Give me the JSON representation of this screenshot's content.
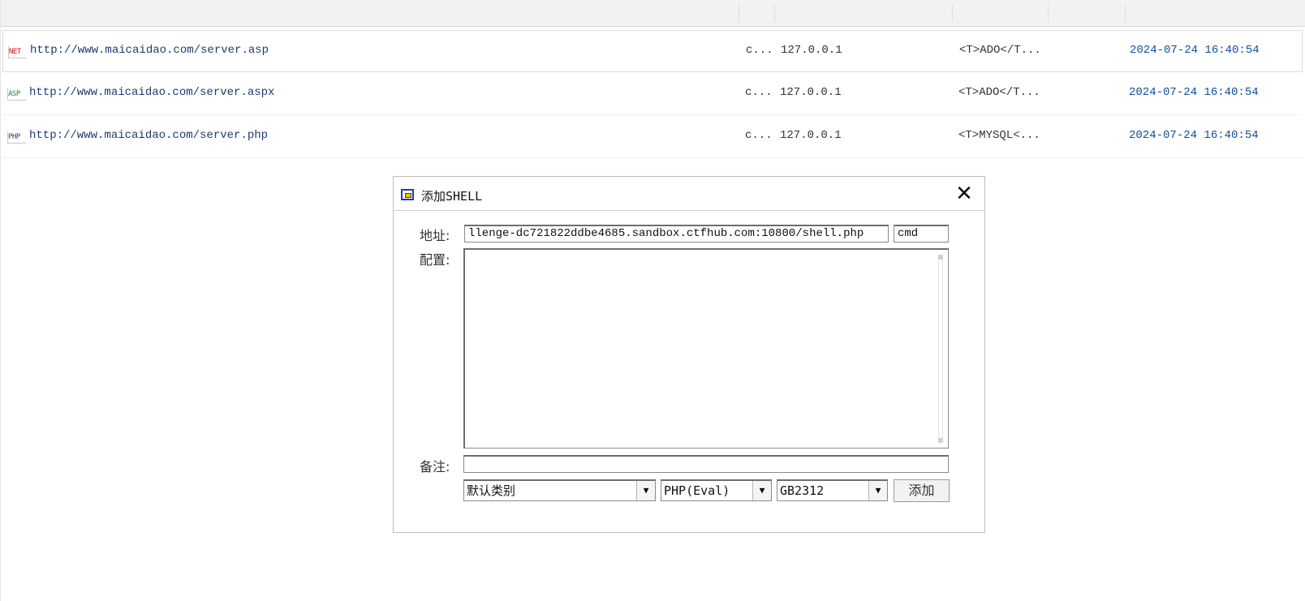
{
  "list": {
    "rows": [
      {
        "type_icon": "NET",
        "icon_name": "net-file-icon",
        "url": "http://www.maicaidao.com/server.asp",
        "c": "c...",
        "ip": "127.0.0.1",
        "config": "<T>ADO</T...",
        "time": "2024-07-24 16:40:54"
      },
      {
        "type_icon": "ASP",
        "icon_name": "asp-file-icon",
        "url": "http://www.maicaidao.com/server.aspx",
        "c": "c...",
        "ip": "127.0.0.1",
        "config": "<T>ADO</T...",
        "time": "2024-07-24 16:40:54"
      },
      {
        "type_icon": "PHP",
        "icon_name": "php-file-icon",
        "url": "http://www.maicaidao.com/server.php",
        "c": "c...",
        "ip": "127.0.0.1",
        "config": "<T>MYSQL<...",
        "time": "2024-07-24 16:40:54"
      }
    ]
  },
  "dialog": {
    "title": "添加SHELL",
    "close_glyph": "✕",
    "address_label": "地址:",
    "address_value": "llenge-dc721822ddbe4685.sandbox.ctfhub.com:10800/shell.php",
    "password_value": "cmd",
    "config_label": "配置:",
    "config_value": "",
    "remark_label": "备注:",
    "remark_value": "",
    "category_value": "默认类别",
    "script_type_value": "PHP(Eval)",
    "encoding_value": "GB2312",
    "add_button_label": "添加",
    "dropdown_arrow": "▼"
  },
  "colors": {
    "url_text": "#1d3a70",
    "time_text": "#0f4fa0",
    "net_icon": "#c8141a",
    "asp_icon": "#2e7d32",
    "php_icon": "#3b3b6b"
  }
}
